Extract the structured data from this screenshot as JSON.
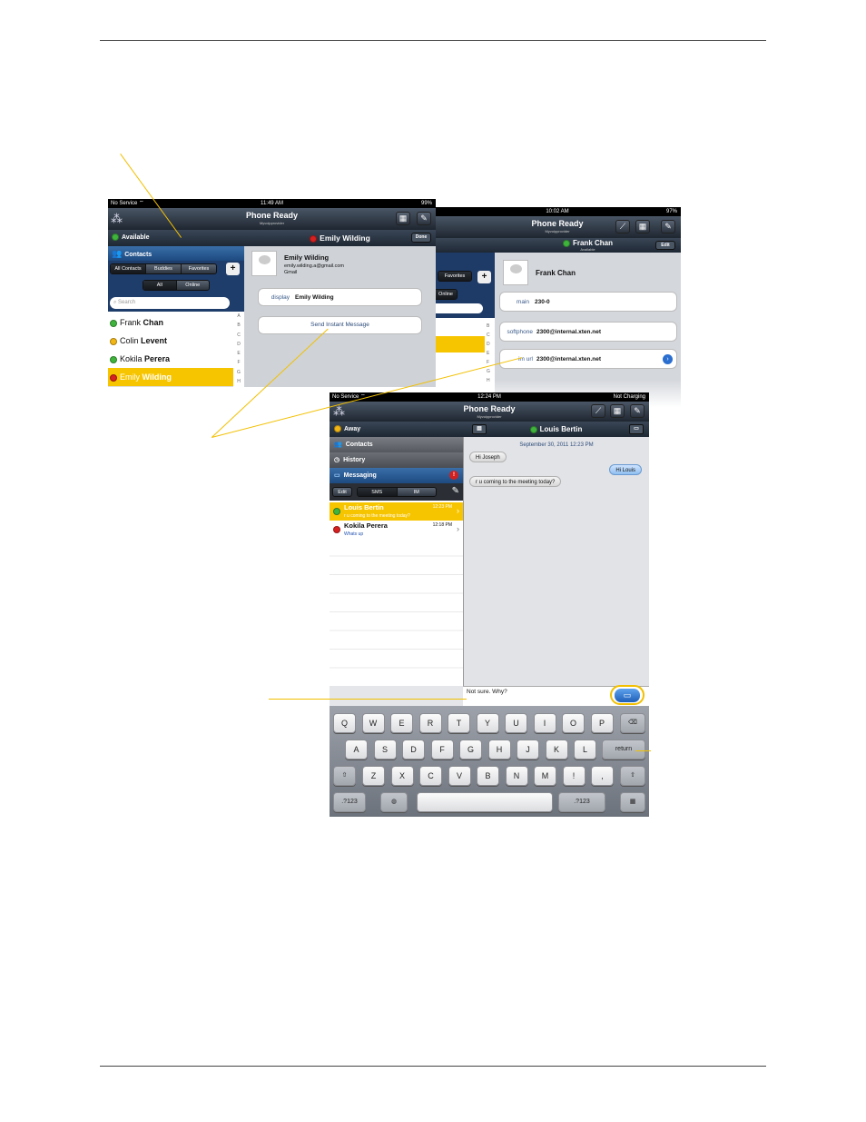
{
  "screen1": {
    "status_left": "No Service",
    "status_time": "11:49 AM",
    "status_batt": "99%",
    "title": "Phone Ready",
    "subtitle": "Myvoipprovider",
    "presence": "Available",
    "contacts_label": "Contacts",
    "seg_filter": [
      "All Contacts",
      "Buddies",
      "Favorites"
    ],
    "seg_online": [
      "All",
      "Online"
    ],
    "add_label": "+",
    "search_placeholder": "Search",
    "contacts": [
      {
        "first": "Frank",
        "last": "Chan",
        "status": "green"
      },
      {
        "first": "Colin",
        "last": "Levent",
        "status": "yellow"
      },
      {
        "first": "Kokila",
        "last": "Perera",
        "status": "green"
      },
      {
        "first": "Emily",
        "last": "Wilding",
        "status": "red"
      }
    ],
    "index_letters": [
      "A",
      "B",
      "C",
      "D",
      "E",
      "F",
      "G",
      "H"
    ],
    "detail_title": "Emily Wilding",
    "done_label": "Done",
    "detail_name": "Emily Wilding",
    "detail_email": "emily.wilding.a@gmail.com",
    "detail_source": "Gmail",
    "display_label": "display",
    "display_value": "Emily Wilding",
    "send_im_label": "Send Instant Message"
  },
  "screen2": {
    "status_time": "10:02 AM",
    "status_batt": "97%",
    "title": "Phone Ready",
    "subtitle": "Myvoipprovider",
    "detail_title": "Frank Chan",
    "detail_sub": "Available",
    "edit_label": "Edit",
    "name": "Frank Chan",
    "favorites_label": "Favorites",
    "online_label": "Online",
    "add_label": "+",
    "index_letters": [
      "B",
      "C",
      "D",
      "E",
      "F",
      "G",
      "H"
    ],
    "fields": [
      {
        "label": "main",
        "value": "230-0"
      },
      {
        "label": "softphone",
        "value": "2300@internal.xten.net"
      },
      {
        "label": "im url",
        "value": "2300@internal.xten.net"
      }
    ]
  },
  "screen3": {
    "status_left": "No Service",
    "status_time": "12:24 PM",
    "status_right": "Not Charging",
    "title": "Phone Ready",
    "subtitle": "Myvoipprovider",
    "presence": "Away",
    "nav": [
      "Contacts",
      "History",
      "Messaging"
    ],
    "badge": "!",
    "seg": [
      "Edit",
      "SMS",
      "IM"
    ],
    "conversations": [
      {
        "name": "Louis Bertin",
        "time": "12:23 PM",
        "preview": "r u coming to the meeting today?",
        "status": "green"
      },
      {
        "name": "Kokila Perera",
        "time": "12:18 PM",
        "preview": "Whats up",
        "status": "red"
      }
    ],
    "chat_title": "Louis Bertin",
    "chat_date": "September 30, 2011 12:23 PM",
    "messages": [
      {
        "text": "Hi Joseph",
        "side": "in"
      },
      {
        "text": "Hi Louis",
        "side": "out"
      },
      {
        "text": "r u coming to the meeting today?",
        "side": "in"
      }
    ],
    "input_text": "Not sure. Why?",
    "keyboard": {
      "row1": [
        "Q",
        "W",
        "E",
        "R",
        "T",
        "Y",
        "U",
        "I",
        "O",
        "P"
      ],
      "row2": [
        "A",
        "S",
        "D",
        "F",
        "G",
        "H",
        "J",
        "K",
        "L"
      ],
      "return": "return",
      "row3": [
        "Z",
        "X",
        "C",
        "V",
        "B",
        "N",
        "M",
        "!",
        ","
      ],
      "row3b": [
        "?",
        "."
      ],
      "num": ".?123",
      "shift": "⇧",
      "backspace": "⌫",
      "globe": "◍",
      "hide": "▦"
    }
  }
}
